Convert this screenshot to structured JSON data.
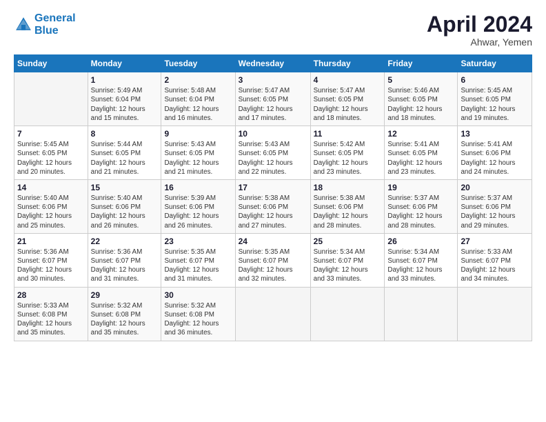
{
  "logo": {
    "line1": "General",
    "line2": "Blue"
  },
  "title": "April 2024",
  "location": "Ahwar, Yemen",
  "weekdays": [
    "Sunday",
    "Monday",
    "Tuesday",
    "Wednesday",
    "Thursday",
    "Friday",
    "Saturday"
  ],
  "weeks": [
    [
      {
        "day": "",
        "info": ""
      },
      {
        "day": "1",
        "info": "Sunrise: 5:49 AM\nSunset: 6:04 PM\nDaylight: 12 hours\nand 15 minutes."
      },
      {
        "day": "2",
        "info": "Sunrise: 5:48 AM\nSunset: 6:04 PM\nDaylight: 12 hours\nand 16 minutes."
      },
      {
        "day": "3",
        "info": "Sunrise: 5:47 AM\nSunset: 6:05 PM\nDaylight: 12 hours\nand 17 minutes."
      },
      {
        "day": "4",
        "info": "Sunrise: 5:47 AM\nSunset: 6:05 PM\nDaylight: 12 hours\nand 18 minutes."
      },
      {
        "day": "5",
        "info": "Sunrise: 5:46 AM\nSunset: 6:05 PM\nDaylight: 12 hours\nand 18 minutes."
      },
      {
        "day": "6",
        "info": "Sunrise: 5:45 AM\nSunset: 6:05 PM\nDaylight: 12 hours\nand 19 minutes."
      }
    ],
    [
      {
        "day": "7",
        "info": "Sunrise: 5:45 AM\nSunset: 6:05 PM\nDaylight: 12 hours\nand 20 minutes."
      },
      {
        "day": "8",
        "info": "Sunrise: 5:44 AM\nSunset: 6:05 PM\nDaylight: 12 hours\nand 21 minutes."
      },
      {
        "day": "9",
        "info": "Sunrise: 5:43 AM\nSunset: 6:05 PM\nDaylight: 12 hours\nand 21 minutes."
      },
      {
        "day": "10",
        "info": "Sunrise: 5:43 AM\nSunset: 6:05 PM\nDaylight: 12 hours\nand 22 minutes."
      },
      {
        "day": "11",
        "info": "Sunrise: 5:42 AM\nSunset: 6:05 PM\nDaylight: 12 hours\nand 23 minutes."
      },
      {
        "day": "12",
        "info": "Sunrise: 5:41 AM\nSunset: 6:05 PM\nDaylight: 12 hours\nand 23 minutes."
      },
      {
        "day": "13",
        "info": "Sunrise: 5:41 AM\nSunset: 6:06 PM\nDaylight: 12 hours\nand 24 minutes."
      }
    ],
    [
      {
        "day": "14",
        "info": "Sunrise: 5:40 AM\nSunset: 6:06 PM\nDaylight: 12 hours\nand 25 minutes."
      },
      {
        "day": "15",
        "info": "Sunrise: 5:40 AM\nSunset: 6:06 PM\nDaylight: 12 hours\nand 26 minutes."
      },
      {
        "day": "16",
        "info": "Sunrise: 5:39 AM\nSunset: 6:06 PM\nDaylight: 12 hours\nand 26 minutes."
      },
      {
        "day": "17",
        "info": "Sunrise: 5:38 AM\nSunset: 6:06 PM\nDaylight: 12 hours\nand 27 minutes."
      },
      {
        "day": "18",
        "info": "Sunrise: 5:38 AM\nSunset: 6:06 PM\nDaylight: 12 hours\nand 28 minutes."
      },
      {
        "day": "19",
        "info": "Sunrise: 5:37 AM\nSunset: 6:06 PM\nDaylight: 12 hours\nand 28 minutes."
      },
      {
        "day": "20",
        "info": "Sunrise: 5:37 AM\nSunset: 6:06 PM\nDaylight: 12 hours\nand 29 minutes."
      }
    ],
    [
      {
        "day": "21",
        "info": "Sunrise: 5:36 AM\nSunset: 6:07 PM\nDaylight: 12 hours\nand 30 minutes."
      },
      {
        "day": "22",
        "info": "Sunrise: 5:36 AM\nSunset: 6:07 PM\nDaylight: 12 hours\nand 31 minutes."
      },
      {
        "day": "23",
        "info": "Sunrise: 5:35 AM\nSunset: 6:07 PM\nDaylight: 12 hours\nand 31 minutes."
      },
      {
        "day": "24",
        "info": "Sunrise: 5:35 AM\nSunset: 6:07 PM\nDaylight: 12 hours\nand 32 minutes."
      },
      {
        "day": "25",
        "info": "Sunrise: 5:34 AM\nSunset: 6:07 PM\nDaylight: 12 hours\nand 33 minutes."
      },
      {
        "day": "26",
        "info": "Sunrise: 5:34 AM\nSunset: 6:07 PM\nDaylight: 12 hours\nand 33 minutes."
      },
      {
        "day": "27",
        "info": "Sunrise: 5:33 AM\nSunset: 6:07 PM\nDaylight: 12 hours\nand 34 minutes."
      }
    ],
    [
      {
        "day": "28",
        "info": "Sunrise: 5:33 AM\nSunset: 6:08 PM\nDaylight: 12 hours\nand 35 minutes."
      },
      {
        "day": "29",
        "info": "Sunrise: 5:32 AM\nSunset: 6:08 PM\nDaylight: 12 hours\nand 35 minutes."
      },
      {
        "day": "30",
        "info": "Sunrise: 5:32 AM\nSunset: 6:08 PM\nDaylight: 12 hours\nand 36 minutes."
      },
      {
        "day": "",
        "info": ""
      },
      {
        "day": "",
        "info": ""
      },
      {
        "day": "",
        "info": ""
      },
      {
        "day": "",
        "info": ""
      }
    ]
  ]
}
